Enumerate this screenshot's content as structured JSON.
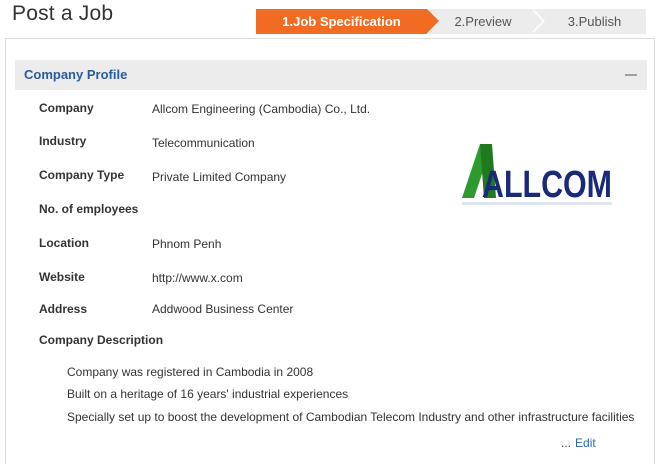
{
  "page": {
    "title": "Post a Job"
  },
  "steps": [
    {
      "label": "1.Job Specification",
      "active": true
    },
    {
      "label": "2.Preview",
      "active": false
    },
    {
      "label": "3.Publish",
      "active": false
    }
  ],
  "colors": {
    "accent": "#f26b22",
    "section_title": "#2b5b9a",
    "link": "#2b6aa8",
    "logo_green": "#2e9a2e",
    "logo_navy": "#1a2a7a"
  },
  "company_profile": {
    "title": "Company Profile",
    "collapse_icon": "minus-icon",
    "fields": [
      {
        "label": "Company",
        "value": "Allcom Engineering (Cambodia) Co., Ltd."
      },
      {
        "label": "Industry",
        "value": "Telecommunication"
      },
      {
        "label": "Company Type",
        "value": "Private Limited Company"
      },
      {
        "label": "No. of employees",
        "value": ""
      },
      {
        "label": "Location",
        "value": "Phnom Penh"
      },
      {
        "label": "Website",
        "value": "http://www.x.com"
      },
      {
        "label": "Address",
        "value": "Addwood Business Center"
      }
    ],
    "description_label": "Company Description",
    "description": [
      "Company was registered in Cambodia in 2008",
      "Built on a heritage of 16 years' industrial experiences",
      "Specially set up to boost the development of Cambodian Telecom Industry and other infrastructure facilities"
    ],
    "logo_text": "ALLCOM",
    "edit_prefix": "...",
    "edit_label": "Edit"
  }
}
